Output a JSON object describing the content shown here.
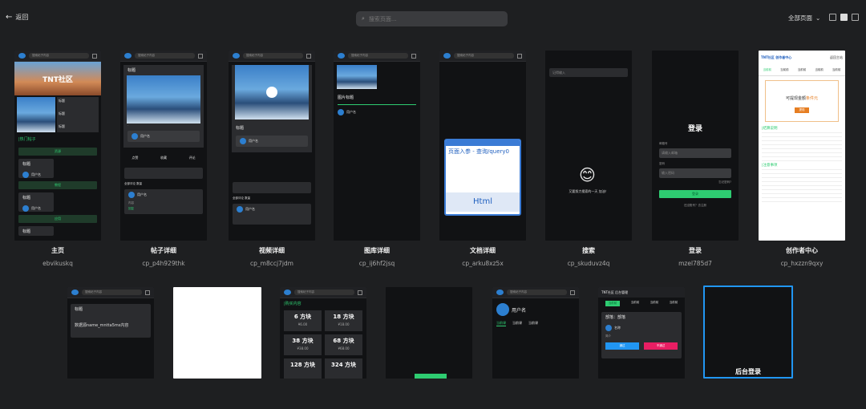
{
  "header": {
    "back_label": "返回",
    "search_placeholder": "搜索页面...",
    "filter_label": "全部页面",
    "view_icons": [
      "desktop-view-icon",
      "tablet-view-icon",
      "mobile-view-icon"
    ]
  },
  "pages": [
    {
      "name": "主页",
      "id": "ebvikuskq"
    },
    {
      "name": "帖子详细",
      "id": "cp_p4h929thk"
    },
    {
      "name": "视频详细",
      "id": "cp_m8ccj7jdm"
    },
    {
      "name": "图库详细",
      "id": "cp_ij6hf2jsq"
    },
    {
      "name": "文档详细",
      "id": "cp_arku8xz5x"
    },
    {
      "name": "搜索",
      "id": "cp_skuduvz4q"
    },
    {
      "name": "登录",
      "id": "mzel785d7"
    },
    {
      "name": "创作者中心",
      "id": "cp_hxzzn9qxy"
    }
  ],
  "thumbs": {
    "search_text": "搜索帖子内容",
    "home": {
      "hot": "|热门帖子",
      "resource": "资源",
      "tutorial": "教程",
      "help": "应用",
      "title": "标题",
      "user": "用户名",
      "banner": "TNT社区"
    },
    "post": {
      "title": "标题",
      "user": "用户名",
      "like": "点赞",
      "collect": "收藏",
      "comment": "评论",
      "all_comments": "全部评论 数量",
      "content": "内容",
      "reply": "回复"
    },
    "video": {
      "title": "标题",
      "user": "用户名",
      "all_comments": "全部评论 数量"
    },
    "gallery": {
      "title": "图片标题",
      "user": "用户名"
    },
    "doc": {
      "url": "页面入参 - 查询/query0",
      "html": "Html"
    },
    "search": {
      "placeholder": "记得输入",
      "hint": "又要努力搜索的一天 加油！",
      "emoji": "😊"
    },
    "login": {
      "title": "登录",
      "email": "邮箱号",
      "email_ph": "请输入邮箱",
      "pwd": "密码",
      "pwd_ph": "输入密码",
      "forgot": "忘记密码?",
      "btn": "登录",
      "register": "还没账号？去注册"
    },
    "creator": {
      "brand": "TNT社区 创作者中心",
      "back": "返回主站",
      "tabs": [
        "当前前",
        "当前前",
        "当前前",
        "当前前",
        "当前前"
      ],
      "amount_label": "可提现金额",
      "amount_tag": "条件",
      "unit": "元",
      "withdraw": "提现",
      "rules": "|结算说明",
      "notes": "|注意事项"
    },
    "row2": {
      "title": "标题",
      "content": "数据源name_mntta5ms内容",
      "buy_title": "|购买内容",
      "prices": [
        {
          "big": "6 方块",
          "small": "¥6.00"
        },
        {
          "big": "18 方块",
          "small": "¥18.00"
        },
        {
          "big": "38 方块",
          "small": "¥38.00"
        },
        {
          "big": "68 方块",
          "small": "¥68.00"
        },
        {
          "big": "128 方块",
          "small": ""
        },
        {
          "big": "324 方块",
          "small": ""
        }
      ],
      "profile_user": "用户名",
      "profile_tabs": [
        "当前课",
        "当前课",
        "当前课"
      ],
      "admin_brand": "TNT社区 后台管理",
      "admin_tabs": [
        "当前前",
        "当前前",
        "当前前",
        "当前前"
      ],
      "admin_section": "部落：部落",
      "admin_name": "名称",
      "admin_tag": "简介",
      "admin_btn1": "通过",
      "admin_btn2": "不通过",
      "backend_login": "后台登录"
    }
  }
}
